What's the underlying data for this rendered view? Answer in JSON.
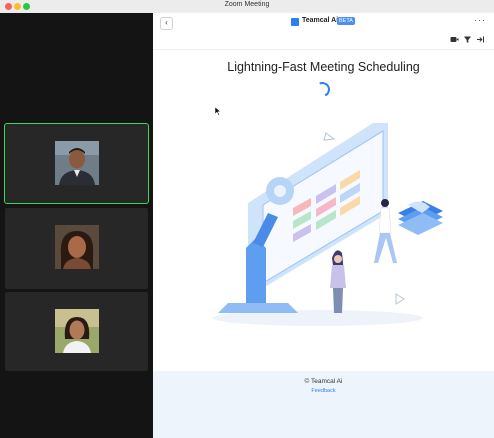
{
  "window": {
    "title": "Zoom Meeting"
  },
  "colors": {
    "active_border": "#3ed65a",
    "accent": "#2f7ff2",
    "footer_bg": "#eef4fc"
  },
  "sidebar": {
    "participants": [
      {
        "avatar": "person-photo",
        "active": true
      },
      {
        "avatar": "person-photo",
        "active": false
      },
      {
        "avatar": "person-photo",
        "active": false
      }
    ]
  },
  "app": {
    "name": "Teamcal Ai",
    "badge": "BETA",
    "back_icon": "chevron-left-icon",
    "more_icon": "ellipsis-icon",
    "toolbar_icons": [
      "video-icon",
      "filter-icon",
      "exit-icon"
    ]
  },
  "main": {
    "heading": "Lightning-Fast Meeting Scheduling",
    "spinner": "loading-spinner"
  },
  "footer": {
    "copyright": "© Teamcal Ai",
    "feedback": "Feedback"
  }
}
